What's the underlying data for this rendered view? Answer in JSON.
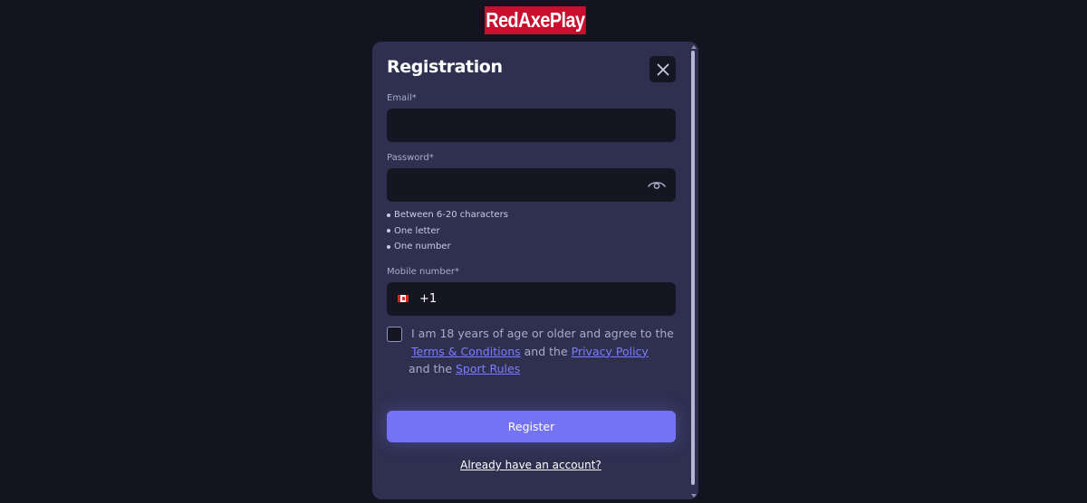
{
  "brand": {
    "logo_text": "RedAxePlay",
    "logo_color": "#c8102e"
  },
  "modal": {
    "title": "Registration",
    "close_icon": "close-icon",
    "email": {
      "label": "Email*",
      "value": "",
      "placeholder": ""
    },
    "password": {
      "label": "Password*",
      "value": "",
      "placeholder": "",
      "toggle_icon": "eye-icon",
      "rules": [
        "Between 6-20 characters",
        "One letter",
        "One number"
      ]
    },
    "mobile": {
      "label": "Mobile number*",
      "flag_icon": "canada-flag-icon",
      "country_code": "+1",
      "value": "",
      "placeholder": ""
    },
    "agreement": {
      "checked": false,
      "text_start": "I am 18 years of age or older and agree to the ",
      "terms_link": "Terms & Conditions",
      "text_and_1": " and the ",
      "privacy_link": "Privacy Policy",
      "text_and_2": " and the ",
      "sport_link": "Sport Rules"
    },
    "register_button": "Register",
    "login_link": "Already have an account?"
  },
  "colors": {
    "background": "#13141f",
    "modal_bg": "#2f3050",
    "field_bg": "#151622",
    "accent": "#7473f5",
    "link": "#7b7dff"
  }
}
